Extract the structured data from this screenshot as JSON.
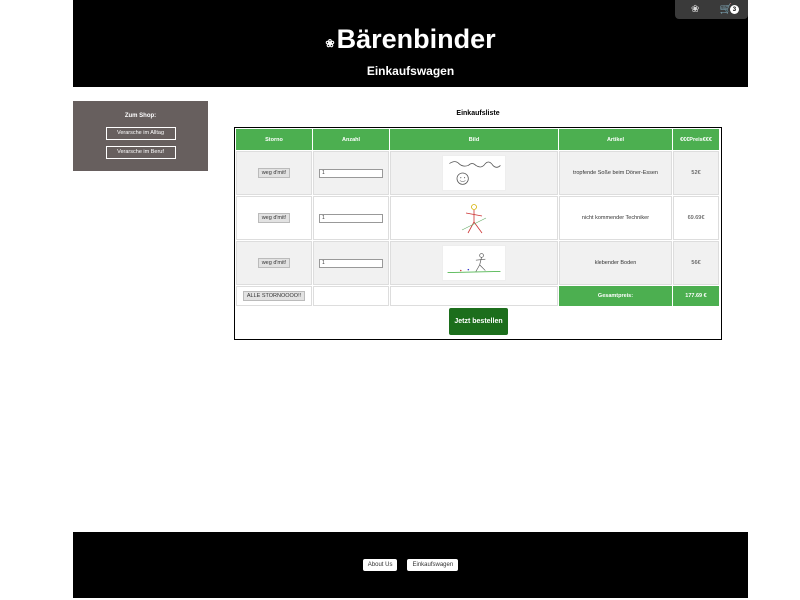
{
  "header": {
    "brand": "Bärenbinder",
    "subtitle": "Einkaufswagen",
    "cart_count": "3",
    "icons": [
      "bear-icon",
      "cart-icon"
    ]
  },
  "sidebar": {
    "title": "Zum Shop:",
    "items": [
      {
        "label": "Verarsche im Alltag"
      },
      {
        "label": "Verarsche im Beruf"
      }
    ]
  },
  "main": {
    "list_title": "Einkaufsliste",
    "columns": [
      "Storno",
      "Anzahl",
      "Bild",
      "Artikel",
      "€€€Preis€€€"
    ],
    "rows": [
      {
        "remove_label": "weg d'mit!",
        "quantity": "1",
        "article": "tropfende Soße beim Döner-Essen",
        "price": "52€"
      },
      {
        "remove_label": "weg d'mit!",
        "quantity": "1",
        "article": "nicht kommender Techniker",
        "price": "69.69€"
      },
      {
        "remove_label": "weg d'mit!",
        "quantity": "1",
        "article": "klebender Boden",
        "price": "56€"
      }
    ],
    "cancel_all_label": "ALLE STORNOOOO!!",
    "total_label": "Gesamtpreis:",
    "total_value": "177.69 €",
    "order_button": "Jetzt bestellen"
  },
  "footer": {
    "links": [
      "About Us",
      "Einkaufswagen"
    ]
  },
  "colors": {
    "accent": "#4caf50",
    "order_button": "#1c6e1c",
    "sidebar": "#675f5e",
    "header": "#000000"
  }
}
